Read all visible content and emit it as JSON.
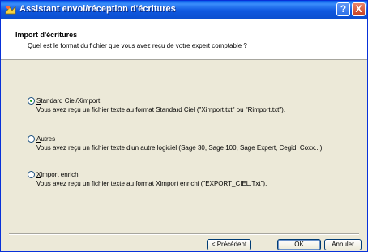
{
  "window": {
    "title": "Assistant envoi/réception d'écritures"
  },
  "titlebar_buttons": {
    "help": "?",
    "close": "X"
  },
  "header": {
    "title": "Import d'écritures",
    "subtitle": "Quel est le format du fichier que vous avez reçu de votre expert comptable ?"
  },
  "options": [
    {
      "label_mnemonic": "S",
      "label_rest": "tandard Ciel/Ximport",
      "label_full": "Standard Ciel/Ximport",
      "description": "Vous avez reçu un fichier texte au format Standard Ciel (\"Ximport.txt\" ou \"Rimport.txt\").",
      "selected": true
    },
    {
      "label_mnemonic": "A",
      "label_rest": "utres",
      "label_full": "Autres",
      "description": "Vous avez reçu un fichier texte d'un autre logiciel (Sage 30, Sage 100, Sage Expert, Cegid, Coxx...).",
      "selected": false
    },
    {
      "label_mnemonic": "X",
      "label_rest": "import enrichi",
      "label_full": "Ximport enrichi",
      "description": "Vous avez reçu un fichier texte au format Ximport enrichi (\"EXPORT_CIEL.Txt\").",
      "selected": false
    }
  ],
  "buttons": {
    "previous": "< Précédent",
    "ok": "OK",
    "cancel": "Annuler"
  },
  "colors": {
    "titlebar": "#0b4fd0",
    "window_bg": "#ece9d8",
    "radio_dot": "#21a121"
  }
}
